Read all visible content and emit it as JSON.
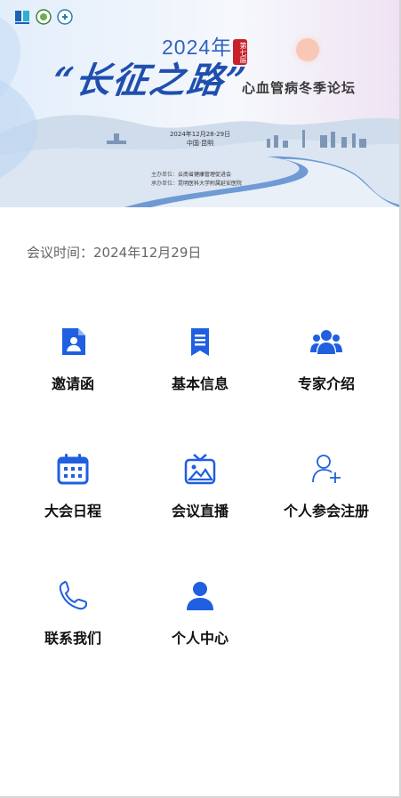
{
  "banner": {
    "year": "2024年",
    "edition_badge": "第七届",
    "calligraphy_title": "“长征之路”",
    "forum_title": "心血管病冬季论坛",
    "date": "2024年12月28-29日",
    "location": "中国·昆明",
    "host_label": "主办单位：",
    "host": "云南省健康管理促进会",
    "organizer_label": "承办单位：",
    "organizer": "昆明医科大学附属延安医院"
  },
  "meeting_time": {
    "label": "会议时间：",
    "value": "2024年12月29日"
  },
  "menu": [
    {
      "label": "邀请函",
      "icon": "invitation-doc-icon"
    },
    {
      "label": "基本信息",
      "icon": "info-bookmark-icon"
    },
    {
      "label": "专家介绍",
      "icon": "experts-group-icon"
    },
    {
      "label": "大会日程",
      "icon": "calendar-icon"
    },
    {
      "label": "会议直播",
      "icon": "tv-live-icon"
    },
    {
      "label": "个人参会注册",
      "icon": "user-add-icon"
    },
    {
      "label": "联系我们",
      "icon": "phone-icon"
    },
    {
      "label": "个人中心",
      "icon": "user-profile-icon"
    }
  ],
  "colors": {
    "accent": "#1f5fe0",
    "text_dark": "#111111",
    "text_muted": "#666666"
  }
}
